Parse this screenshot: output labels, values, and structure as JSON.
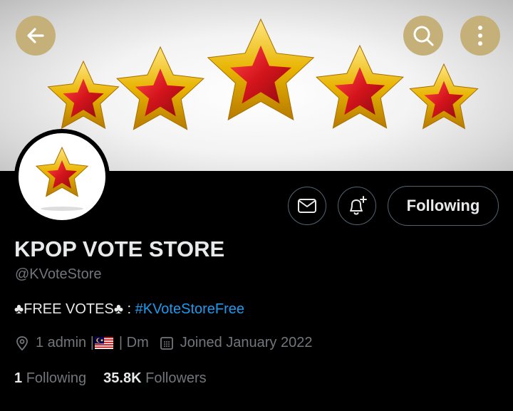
{
  "header": {
    "back_icon": "arrow-left-icon",
    "search_icon": "search-icon",
    "more_icon": "more-vertical-icon",
    "button_color": "#c6b07a"
  },
  "profile": {
    "name": "KPOP VOTE STORE",
    "handle": "@KVoteStore",
    "bio_prefix": "♣FREE VOTES♣ : ",
    "bio_hashtag": "#KVoteStoreFree",
    "location_prefix": "1 admin |",
    "location_suffix": "| Dm",
    "joined": "Joined January 2022",
    "following_count": "1",
    "following_label": "Following",
    "followers_count": "35.8K",
    "followers_label": "Followers"
  },
  "actions": {
    "follow_label": "Following",
    "message_icon": "mail-icon",
    "notify_icon": "bell-plus-icon"
  },
  "colors": {
    "accent": "#1d9bf0",
    "muted": "#71767b",
    "text": "#e7e9ea"
  }
}
